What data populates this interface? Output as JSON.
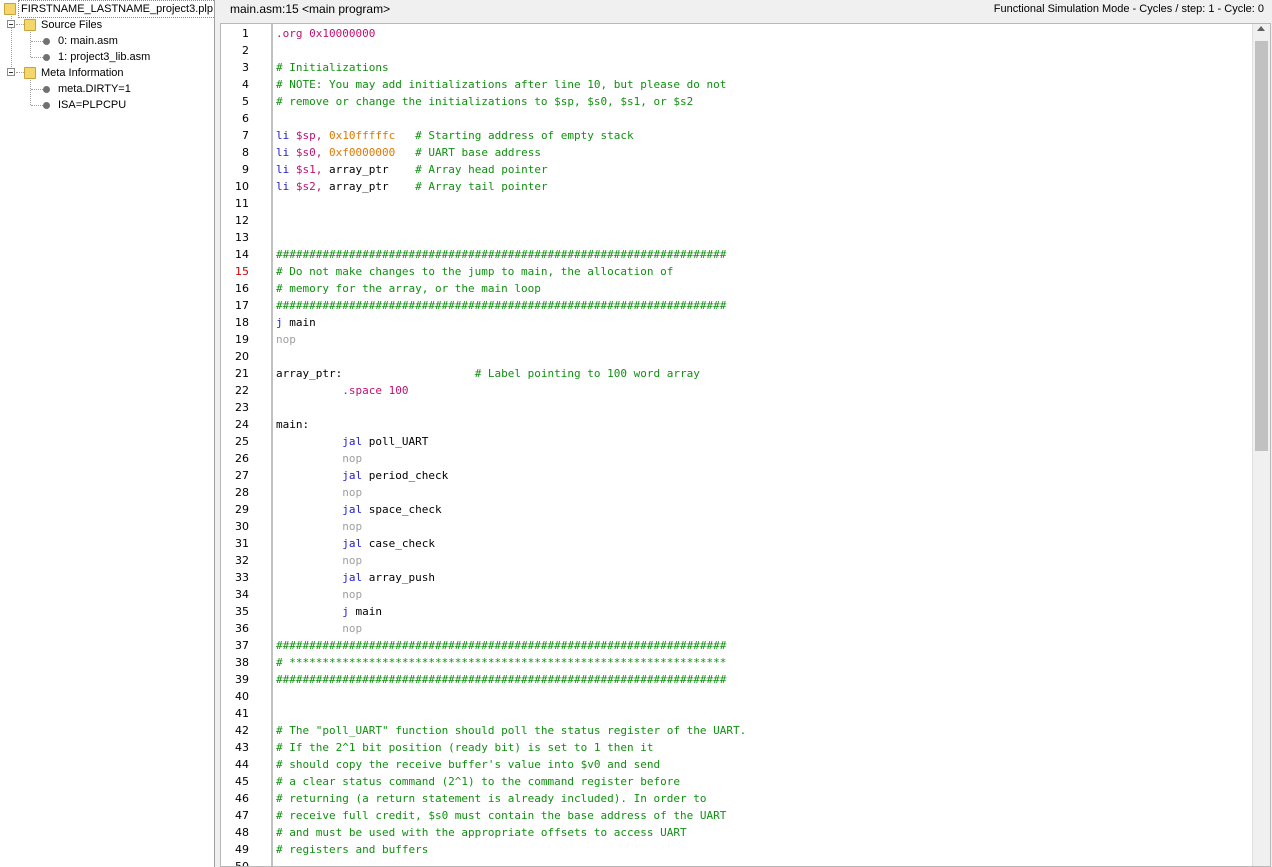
{
  "tree": {
    "project": "FIRSTNAME_LASTNAME_project3.plp",
    "source_files_label": "Source Files",
    "source_files": [
      "0: main.asm",
      "1: project3_lib.asm"
    ],
    "meta_label": "Meta Information",
    "meta_items": [
      "meta.DIRTY=1",
      "ISA=PLPCPU"
    ]
  },
  "header": {
    "location": "main.asm:15 <main program>",
    "mode": "Functional Simulation Mode - Cycles / step: 1 - Cycle: 0"
  },
  "editor": {
    "current_line": 15,
    "lines": [
      [
        [
          "dir",
          ".org "
        ],
        [
          "reg",
          "0x10000000"
        ]
      ],
      [],
      [
        [
          "cm",
          "# Initializations"
        ]
      ],
      [
        [
          "cm",
          "# NOTE: You may add initializations after line 10, but please do not"
        ]
      ],
      [
        [
          "cm",
          "# remove or change the initializations to $sp, $s0, $s1, or $s2"
        ]
      ],
      [],
      [
        [
          "kw",
          "li "
        ],
        [
          "reg",
          "$sp, "
        ],
        [
          "num",
          "0x10fffffc"
        ],
        [
          "txt",
          "   "
        ],
        [
          "cm",
          "# Starting address of empty stack"
        ]
      ],
      [
        [
          "kw",
          "li "
        ],
        [
          "reg",
          "$s0, "
        ],
        [
          "num",
          "0xf0000000"
        ],
        [
          "txt",
          "   "
        ],
        [
          "cm",
          "# UART base address"
        ]
      ],
      [
        [
          "kw",
          "li "
        ],
        [
          "reg",
          "$s1, "
        ],
        [
          "lbl",
          "array_ptr"
        ],
        [
          "txt",
          "    "
        ],
        [
          "cm",
          "# Array head pointer"
        ]
      ],
      [
        [
          "kw",
          "li "
        ],
        [
          "reg",
          "$s2, "
        ],
        [
          "lbl",
          "array_ptr"
        ],
        [
          "txt",
          "    "
        ],
        [
          "cm",
          "# Array tail pointer"
        ]
      ],
      [],
      [],
      [],
      [
        [
          "cm",
          "####################################################################"
        ]
      ],
      [
        [
          "cm",
          "# Do not make changes to the jump to main, the allocation of"
        ]
      ],
      [
        [
          "cm",
          "# memory for the array, or the main loop"
        ]
      ],
      [
        [
          "cm",
          "####################################################################"
        ]
      ],
      [
        [
          "kw",
          "j "
        ],
        [
          "lbl",
          "main"
        ]
      ],
      [
        [
          "nop",
          "nop"
        ]
      ],
      [],
      [
        [
          "lbl",
          "array_ptr:"
        ],
        [
          "txt",
          "                    "
        ],
        [
          "cm",
          "# Label pointing to 100 word array"
        ]
      ],
      [
        [
          "txt",
          "          "
        ],
        [
          "dir",
          ".space 100"
        ]
      ],
      [],
      [
        [
          "lbl",
          "main:"
        ]
      ],
      [
        [
          "txt",
          "          "
        ],
        [
          "kw",
          "jal "
        ],
        [
          "lbl",
          "poll_UART"
        ]
      ],
      [
        [
          "txt",
          "          "
        ],
        [
          "nop",
          "nop"
        ]
      ],
      [
        [
          "txt",
          "          "
        ],
        [
          "kw",
          "jal "
        ],
        [
          "lbl",
          "period_check"
        ]
      ],
      [
        [
          "txt",
          "          "
        ],
        [
          "nop",
          "nop"
        ]
      ],
      [
        [
          "txt",
          "          "
        ],
        [
          "kw",
          "jal "
        ],
        [
          "lbl",
          "space_check"
        ]
      ],
      [
        [
          "txt",
          "          "
        ],
        [
          "nop",
          "nop"
        ]
      ],
      [
        [
          "txt",
          "          "
        ],
        [
          "kw",
          "jal "
        ],
        [
          "lbl",
          "case_check"
        ]
      ],
      [
        [
          "txt",
          "          "
        ],
        [
          "nop",
          "nop"
        ]
      ],
      [
        [
          "txt",
          "          "
        ],
        [
          "kw",
          "jal "
        ],
        [
          "lbl",
          "array_push"
        ]
      ],
      [
        [
          "txt",
          "          "
        ],
        [
          "nop",
          "nop"
        ]
      ],
      [
        [
          "txt",
          "          "
        ],
        [
          "kw",
          "j "
        ],
        [
          "lbl",
          "main"
        ]
      ],
      [
        [
          "txt",
          "          "
        ],
        [
          "nop",
          "nop"
        ]
      ],
      [
        [
          "cm",
          "####################################################################"
        ]
      ],
      [
        [
          "cm",
          "# ******************************************************************"
        ]
      ],
      [
        [
          "cm",
          "####################################################################"
        ]
      ],
      [],
      [],
      [
        [
          "cm",
          "# The \"poll_UART\" function should poll the status register of the UART."
        ]
      ],
      [
        [
          "cm",
          "# If the 2^1 bit position (ready bit) is set to 1 then it"
        ]
      ],
      [
        [
          "cm",
          "# should copy the receive buffer's value into $v0 and send"
        ]
      ],
      [
        [
          "cm",
          "# a clear status command (2^1) to the command register before"
        ]
      ],
      [
        [
          "cm",
          "# returning (a return statement is already included). In order to"
        ]
      ],
      [
        [
          "cm",
          "# receive full credit, $s0 must contain the base address of the UART"
        ]
      ],
      [
        [
          "cm",
          "# and must be used with the appropriate offsets to access UART"
        ]
      ],
      [
        [
          "cm",
          "# registers and buffers"
        ]
      ],
      []
    ]
  }
}
